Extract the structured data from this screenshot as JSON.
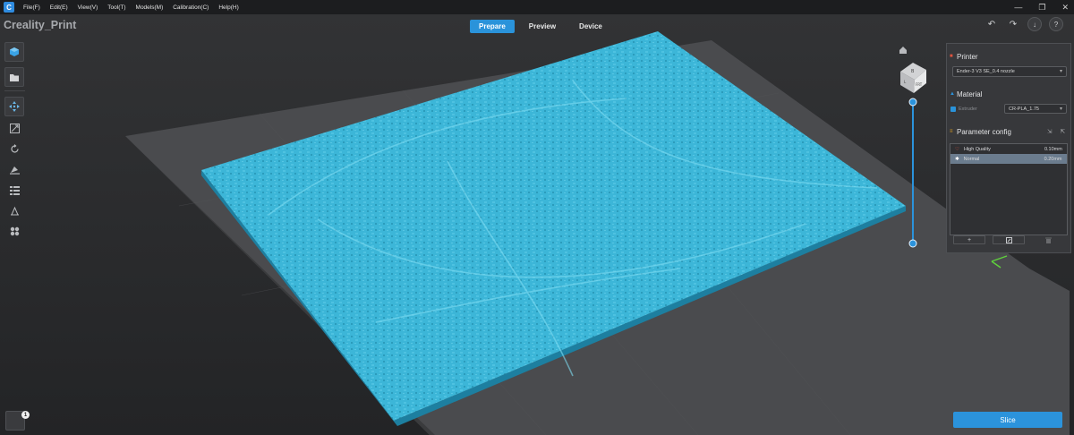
{
  "menu": {
    "items": [
      "File(F)",
      "Edit(E)",
      "View(V)",
      "Tool(T)",
      "Models(M)",
      "Calibration(C)",
      "Help(H)"
    ],
    "minimize": "—",
    "restore": "❐",
    "close": "✕"
  },
  "app": {
    "title": "Creality_Print"
  },
  "modes": {
    "prepare": "Prepare",
    "preview": "Preview",
    "device": "Device",
    "active": "Prepare"
  },
  "toolbar": {
    "undo_icon": "↶",
    "redo_icon": "↷",
    "download_icon": "↓",
    "account_icon": "?"
  },
  "view_cube": {
    "top": "B",
    "front": "FRT",
    "left": "L"
  },
  "panel": {
    "printer_title": "Printer",
    "printer_value": "Ender-3 V3 SE_0.4 nozzle",
    "material_title": "Material",
    "extruder_label": "Extruder",
    "material_value": "CR-PLA_1.75",
    "param_title": "Parameter config",
    "params": [
      {
        "name": "High Quality",
        "value": "0.10mm"
      },
      {
        "name": "Normal",
        "value": "0.20mm"
      }
    ],
    "add_icon": "+"
  },
  "slice": {
    "label": "Slice"
  },
  "notification": {
    "count": "1"
  },
  "colors": {
    "accent": "#2b93dc",
    "model": "#3cb6d8",
    "bed": "#4a4b4e"
  }
}
